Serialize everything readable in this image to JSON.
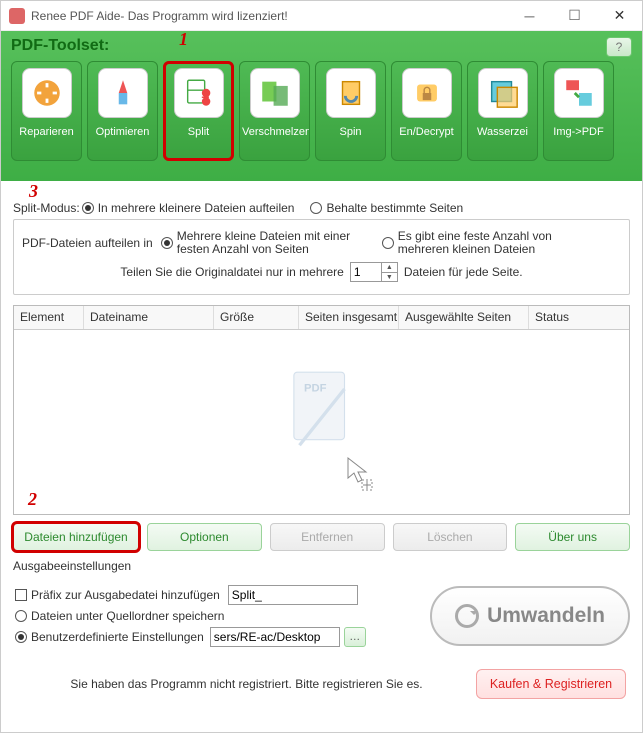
{
  "window": {
    "title": "Renee PDF Aide- Das Programm wird lizenziert!"
  },
  "header": {
    "title": "PDF-Toolset:",
    "help_tooltip": "?"
  },
  "tools": [
    {
      "label": "Reparieren"
    },
    {
      "label": "Optimieren"
    },
    {
      "label": "Split"
    },
    {
      "label": "Verschmelzen"
    },
    {
      "label": "Spin"
    },
    {
      "label": "En/Decrypt"
    },
    {
      "label": "Wasserzei"
    },
    {
      "label": "Img->PDF"
    }
  ],
  "split_mode": {
    "label": "Split-Modus:",
    "opt1": "In mehrere kleinere Dateien aufteilen",
    "opt2": "Behalte bestimmte Seiten"
  },
  "split_options": {
    "label": "PDF-Dateien aufteilen in",
    "optA": "Mehrere kleine Dateien mit einer festen Anzahl von Seiten",
    "optB": "Es gibt eine feste Anzahl von mehreren kleinen Dateien",
    "divide_pre": "Teilen Sie die Originaldatei nur in mehrere",
    "value": "1",
    "divide_post": "Dateien für jede Seite."
  },
  "table": {
    "cols": [
      "Element",
      "Dateiname",
      "Größe",
      "Seiten insgesamt",
      "Ausgewählte Seiten",
      "Status"
    ]
  },
  "buttons": {
    "add": "Dateien hinzufügen",
    "options": "Optionen",
    "remove": "Entfernen",
    "delete": "Löschen",
    "about": "Über uns"
  },
  "output": {
    "title": "Ausgabeeinstellungen",
    "prefix_label": "Präfix zur Ausgabedatei hinzufügen",
    "prefix_value": "Split_",
    "same_folder": "Dateien unter Quellordner speichern",
    "custom_label": "Benutzerdefinierte Einstellungen",
    "custom_value": "sers/RE-ac/Desktop",
    "convert": "Umwandeln"
  },
  "footer": {
    "msg": "Sie haben das Programm nicht registriert. Bitte registrieren Sie es.",
    "buy": "Kaufen & Registrieren"
  },
  "annotations": {
    "a1": "1",
    "a2": "2",
    "a3": "3"
  }
}
